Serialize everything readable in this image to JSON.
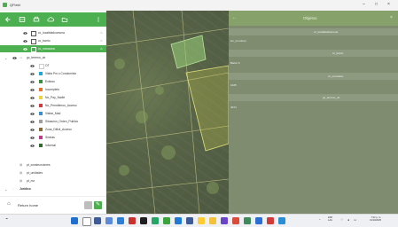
{
  "window": {
    "title": "QField"
  },
  "sidebar": {
    "layers": [
      {
        "label": "cc_localidadcomuna",
        "kind": "checkbox"
      },
      {
        "label": "cc_barrio",
        "kind": "checkbox"
      },
      {
        "label": "cc_manzana",
        "kind": "checkbox",
        "selected": true
      },
      {
        "label": "gc_terreno_ob",
        "kind": "group"
      },
      {
        "label": "OT",
        "kind": "sub",
        "color": "#ffffff"
      },
      {
        "label": "Visita Pm o Condominio",
        "kind": "sub",
        "color": "#1ea7d8"
      },
      {
        "label": "Exitoso",
        "kind": "sub",
        "color": "#3b8e3b"
      },
      {
        "label": "Incompleto",
        "kind": "sub",
        "color": "#e8722a"
      },
      {
        "label": "No_Pay_Nadie",
        "kind": "sub",
        "color": "#f1d23a"
      },
      {
        "label": "No_Permitieron_Acceso",
        "kind": "sub",
        "color": "#d63b3b"
      },
      {
        "label": "Visitar_Mad",
        "kind": "sub",
        "color": "#3a8fd1"
      },
      {
        "label": "Situacion_Orden_Publico",
        "kind": "sub",
        "color": "#9e9e9e"
      },
      {
        "label": "Zona_Dificil_Acceso",
        "kind": "sub",
        "color": "#8a6a3a"
      },
      {
        "label": "Sininas",
        "kind": "sub",
        "color": "#c0398a"
      },
      {
        "label": "Informal",
        "kind": "sub",
        "color": "#2e6b2e"
      },
      {
        "label": "pt_construcciones",
        "kind": "plain"
      },
      {
        "label": "pt_unidades",
        "kind": "plain"
      },
      {
        "label": "pt_mz",
        "kind": "plain"
      },
      {
        "label": "Juridico",
        "kind": "groupbold"
      }
    ],
    "bottom_label": "Return home"
  },
  "panel": {
    "title": "Objetos",
    "rows": [
      {
        "left": "",
        "right": "cc_localidadcomuna"
      },
      {
        "left": "loc_(nombre)",
        "right": ""
      },
      {
        "left": "",
        "right": "cc_barrio"
      },
      {
        "left": "Barrio 6",
        "right": ""
      },
      {
        "left": "",
        "right": "cc_manzana"
      },
      {
        "left": "1025",
        "right": ""
      },
      {
        "left": "",
        "right": "gc_terreno_ob"
      },
      {
        "left": "4074",
        "right": ""
      }
    ]
  },
  "taskbar": {
    "time": "7:22 p. m.",
    "date": "31/10/2025",
    "lang_top": "ESP",
    "lang_bottom": "LAA"
  },
  "colors": {
    "accent": "#4caf50",
    "panel": "#7f8c6f"
  }
}
